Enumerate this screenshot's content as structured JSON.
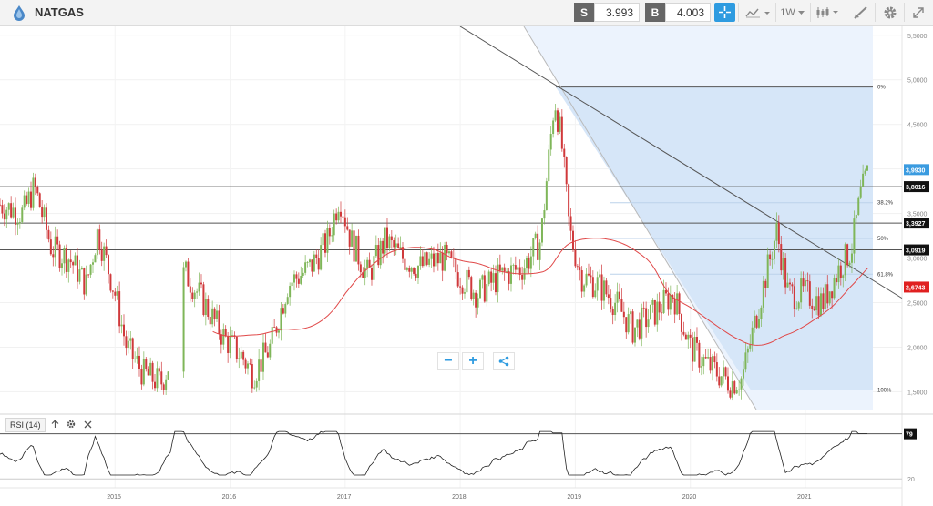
{
  "header": {
    "symbol": "NATGAS",
    "sell_label": "S",
    "sell_price": "3.993",
    "buy_label": "B",
    "buy_price": "4.003",
    "timeframe": "1W",
    "icons": [
      "crosshair-icon",
      "chart-type-icon",
      "candles-icon",
      "draw-icon",
      "gear-icon",
      "expand-icon"
    ]
  },
  "zoom": {
    "minus": "−",
    "plus": "+"
  },
  "rsi": {
    "label": "RSI (14)",
    "value_label": "79",
    "level_low": "20"
  },
  "price_axis": {
    "ticks": [
      "5,5000",
      "5,0000",
      "4,5000",
      "4,0000",
      "3,5000",
      "3,0000",
      "2,5000",
      "2,0000",
      "1,5000"
    ],
    "markers": [
      {
        "label": "3,9930",
        "color": "#3a9be0"
      },
      {
        "label": "3,8016",
        "color": "#111111"
      },
      {
        "label": "3,3927",
        "color": "#111111"
      },
      {
        "label": "3,0919",
        "color": "#111111"
      },
      {
        "label": "2,6743",
        "color": "#e02020"
      }
    ]
  },
  "fibonacci": {
    "labels": [
      "0%",
      "38.2%",
      "50%",
      "61.8%",
      "100%"
    ]
  },
  "time_axis": [
    "2015",
    "2016",
    "2017",
    "2018",
    "2019",
    "2020",
    "2021"
  ],
  "chart_data": {
    "type": "candlestick",
    "instrument": "NATGAS",
    "timeframe": "1W",
    "ylim": [
      1.3,
      5.6
    ],
    "horizontal_levels": [
      3.8016,
      3.3927,
      3.0919
    ],
    "moving_average_last": 2.6743,
    "fib_high": 4.92,
    "fib_low": 1.52,
    "approx_close_path": [
      {
        "t": 2014.0,
        "v": 3.6
      },
      {
        "t": 2014.2,
        "v": 3.5
      },
      {
        "t": 2014.3,
        "v": 3.8
      },
      {
        "t": 2014.45,
        "v": 3.1
      },
      {
        "t": 2014.6,
        "v": 3.0
      },
      {
        "t": 2014.75,
        "v": 2.7
      },
      {
        "t": 2014.85,
        "v": 3.3
      },
      {
        "t": 2015.0,
        "v": 2.6
      },
      {
        "t": 2015.1,
        "v": 2.0
      },
      {
        "t": 2015.25,
        "v": 1.7
      },
      {
        "t": 2015.4,
        "v": 1.6
      },
      {
        "t": 2015.5,
        "v": 1.9
      },
      {
        "t": 2015.6,
        "v": 2.85
      },
      {
        "t": 2015.75,
        "v": 2.55
      },
      {
        "t": 2015.95,
        "v": 2.1
      },
      {
        "t": 2016.1,
        "v": 1.9
      },
      {
        "t": 2016.2,
        "v": 1.7
      },
      {
        "t": 2016.35,
        "v": 2.0
      },
      {
        "t": 2016.5,
        "v": 2.7
      },
      {
        "t": 2016.7,
        "v": 2.9
      },
      {
        "t": 2016.85,
        "v": 3.2
      },
      {
        "t": 2016.95,
        "v": 3.7
      },
      {
        "t": 2017.05,
        "v": 3.2
      },
      {
        "t": 2017.2,
        "v": 2.8
      },
      {
        "t": 2017.35,
        "v": 3.2
      },
      {
        "t": 2017.5,
        "v": 3.0
      },
      {
        "t": 2017.65,
        "v": 2.9
      },
      {
        "t": 2017.85,
        "v": 3.0
      },
      {
        "t": 2018.0,
        "v": 2.8
      },
      {
        "t": 2018.15,
        "v": 2.6
      },
      {
        "t": 2018.35,
        "v": 2.8
      },
      {
        "t": 2018.55,
        "v": 2.9
      },
      {
        "t": 2018.7,
        "v": 3.2
      },
      {
        "t": 2018.82,
        "v": 4.8
      },
      {
        "t": 2018.88,
        "v": 4.3
      },
      {
        "t": 2018.95,
        "v": 3.3
      },
      {
        "t": 2019.05,
        "v": 2.8
      },
      {
        "t": 2019.2,
        "v": 2.7
      },
      {
        "t": 2019.35,
        "v": 2.5
      },
      {
        "t": 2019.5,
        "v": 2.2
      },
      {
        "t": 2019.7,
        "v": 2.4
      },
      {
        "t": 2019.85,
        "v": 2.6
      },
      {
        "t": 2020.0,
        "v": 2.0
      },
      {
        "t": 2020.15,
        "v": 1.8
      },
      {
        "t": 2020.35,
        "v": 1.6
      },
      {
        "t": 2020.45,
        "v": 1.65
      },
      {
        "t": 2020.6,
        "v": 2.5
      },
      {
        "t": 2020.75,
        "v": 3.3
      },
      {
        "t": 2020.85,
        "v": 2.6
      },
      {
        "t": 2021.0,
        "v": 2.6
      },
      {
        "t": 2021.15,
        "v": 2.5
      },
      {
        "t": 2021.3,
        "v": 2.9
      },
      {
        "t": 2021.4,
        "v": 3.1
      },
      {
        "t": 2021.48,
        "v": 3.7
      },
      {
        "t": 2021.55,
        "v": 3.99
      }
    ]
  }
}
